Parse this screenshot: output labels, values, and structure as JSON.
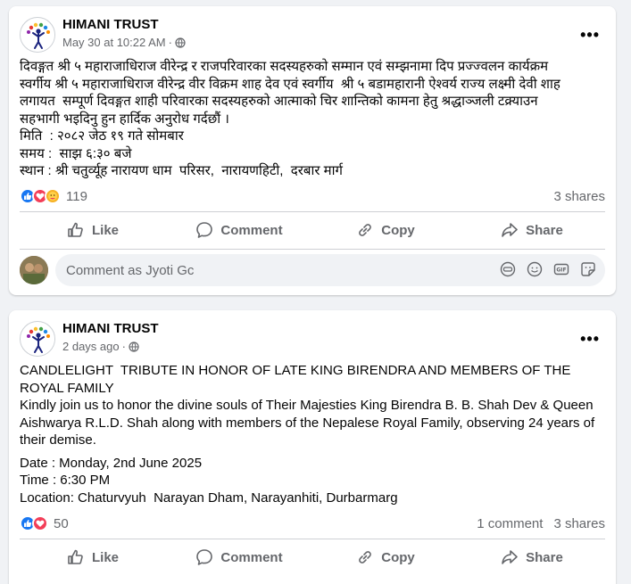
{
  "posts": [
    {
      "author": "HIMANI TRUST",
      "timestamp": "May 30 at 10:22 AM",
      "sep": "·",
      "privacy_icon": "globe-icon",
      "lines": [
        "दिवङ्गत श्री ५ महाराजाधिराज वीरेन्द्र र राजपरिवारका सदस्यहरुको सम्मान एवं सम्झनामा दिप प्रज्ज्वलन कार्यक्रम",
        "स्वर्गीय श्री ५ महाराजाधिराज वीरेन्द्र वीर विक्रम शाह देव एवं स्वर्गीय  श्री ५ बडामहारानी ऐश्वर्य राज्य लक्ष्मी देवी शाह",
        "लगायत  सम्पूर्ण दिवङ्गत शाही परिवारका सदस्यहरुको आत्माको चिर शान्तिको कामना हेतु श्रद्धाञ्जली टक्र्याउन",
        "सहभागी भइदिनु हुन हार्दिक अनुरोध गर्दछौं ।",
        "मिति  : २०८२ जेठ १९ गते सोमबार",
        "समय :  साझ ६:३० बजे",
        "स्थान : श्री चतुर्व्यूह नारायण धाम  परिसर,  नारायणहिटी,  दरबार मार्ग"
      ],
      "reaction_count": "119",
      "comments": "",
      "shares": "3 shares",
      "actions": {
        "like": "Like",
        "comment": "Comment",
        "copy": "Copy",
        "share": "Share"
      },
      "comment_placeholder": "Comment as Jyoti Gc"
    },
    {
      "author": "HIMANI TRUST",
      "timestamp": "2 days ago",
      "sep": "·",
      "privacy_icon": "globe-icon",
      "paragraph1": "CANDLELIGHT  TRIBUTE IN HONOR OF LATE KING BIRENDRA AND MEMBERS OF THE ROYAL FAMILY\nKindly join us to honor the divine souls of Their Majesties King Birendra B. B. Shah Dev & Queen Aishwarya R.L.D. Shah along with members of the Nepalese Royal Family, observing 24 years of their demise.",
      "paragraph2": "Date : Monday, 2nd June 2025\nTime : 6:30 PM\nLocation: Chaturvyuh  Narayan Dham, Narayanhiti, Durbarmarg",
      "reaction_count": "50",
      "comments": "1 comment",
      "shares": "3 shares",
      "actions": {
        "like": "Like",
        "comment": "Comment",
        "copy": "Copy",
        "share": "Share"
      }
    }
  ],
  "colors": {
    "brand_blue": "#1877f2",
    "love_red": "#f33e58",
    "care_yellow": "#f7b125",
    "secondary_text": "#65676b"
  }
}
